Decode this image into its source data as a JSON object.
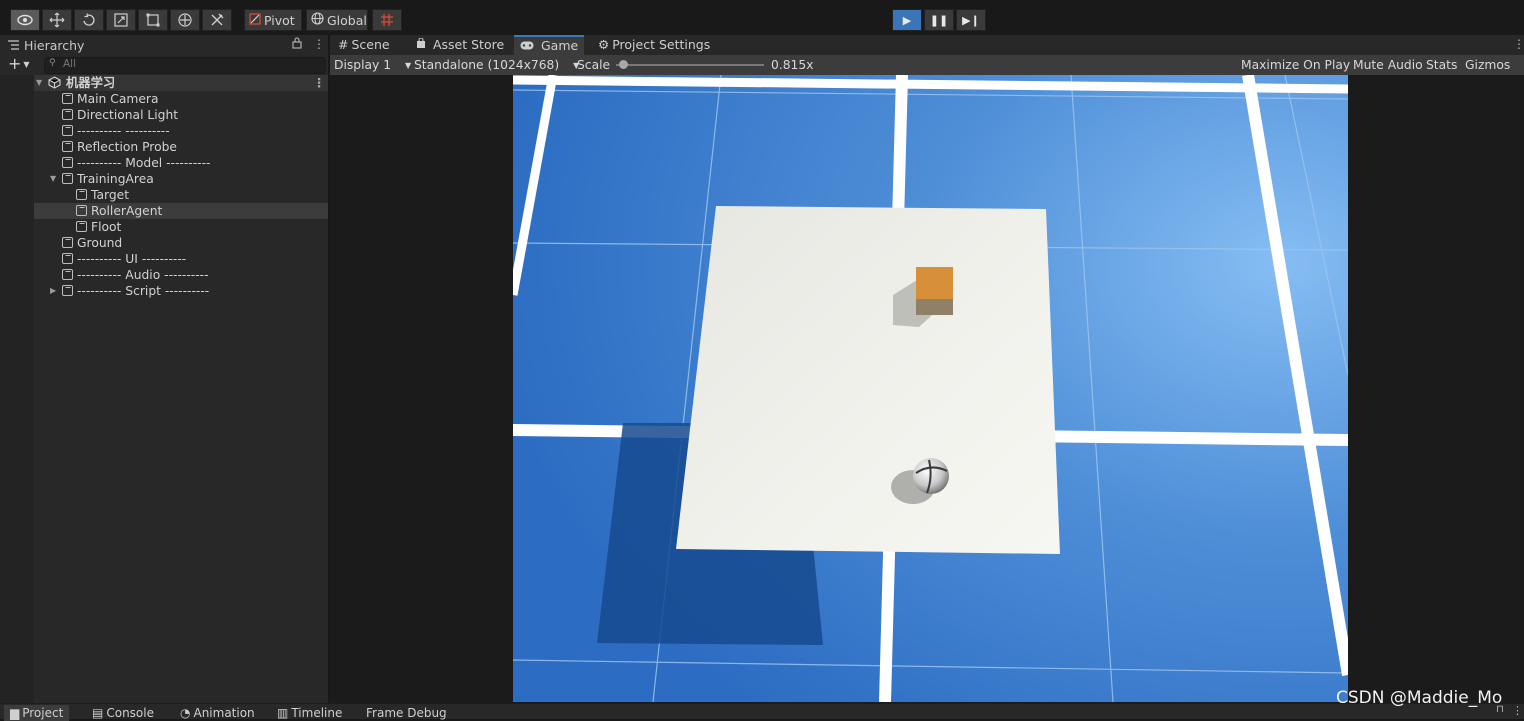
{
  "toolbar": {
    "pivot_label": "Pivot",
    "global_label": "Global",
    "colors": {
      "active_play": "#3a75b8",
      "background": "#191919"
    }
  },
  "hierarchy": {
    "tab_label": "Hierarchy",
    "search_placeholder": "All",
    "scene_name": "机器学习",
    "items": [
      {
        "label": "Main Camera"
      },
      {
        "label": "Directional Light"
      },
      {
        "label": "---------- ----------"
      },
      {
        "label": "Reflection Probe"
      },
      {
        "label": "---------- Model ----------"
      },
      {
        "label": "TrainingArea"
      },
      {
        "label": "Target"
      },
      {
        "label": "RollerAgent"
      },
      {
        "label": "Floot"
      },
      {
        "label": "Ground"
      },
      {
        "label": "---------- UI ----------"
      },
      {
        "label": "---------- Audio ----------"
      },
      {
        "label": "---------- Script ----------"
      }
    ]
  },
  "editor_tabs": {
    "scene": "Scene",
    "asset_store": "Asset Store",
    "game": "Game",
    "project_settings": "Project Settings"
  },
  "game_bar": {
    "display": "Display 1",
    "resolution": "Standalone (1024x768)",
    "scale_label": "Scale",
    "scale_value": "0.815x",
    "scale_fraction": 0.02,
    "maximize": "Maximize On Play",
    "mute": "Mute Audio",
    "stats": "Stats",
    "gizmos": "Gizmos"
  },
  "bottom_tabs": {
    "project": "Project",
    "console": "Console",
    "animation": "Animation",
    "timeline": "Timeline",
    "frame_debug": "Frame Debug"
  },
  "watermark": "CSDN @Maddie_Mo",
  "scene_colors": {
    "ground_blue": "#3a78c6",
    "platform": "#ecece6",
    "target_cube": "#d78f3a",
    "agent_ball": "#e3e3e3"
  }
}
